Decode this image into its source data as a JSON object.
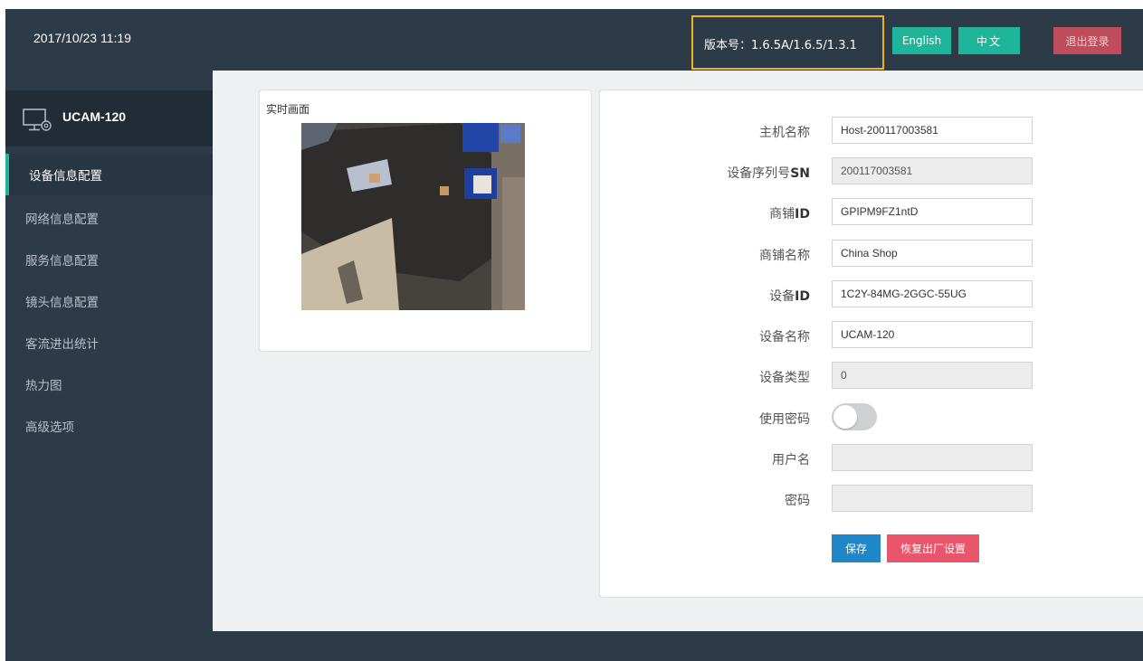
{
  "header": {
    "datetime": "2017/10/23 11:19",
    "version": "版本号：1.6.5A/1.6.5/1.3.1",
    "lang_english": "English",
    "lang_chinese": "中文",
    "logout": "退出登录"
  },
  "sidebar": {
    "device_name": "UCAM-120",
    "device_icon": "monitor-settings-icon",
    "items": [
      {
        "label": "设备信息配置",
        "active": true
      },
      {
        "label": "网络信息配置",
        "active": false
      },
      {
        "label": "服务信息配置",
        "active": false
      },
      {
        "label": "镜头信息配置",
        "active": false
      },
      {
        "label": "客流进出统计",
        "active": false
      },
      {
        "label": "热力图",
        "active": false
      },
      {
        "label": "高级选项",
        "active": false
      }
    ]
  },
  "preview": {
    "title": "实时画面"
  },
  "form": {
    "host_name_label": "主机名称",
    "host_name_value": "Host-200117003581",
    "sn_label_cn": "设备序列号",
    "sn_label_en": "SN",
    "sn_value": "200117003581",
    "shop_id_label_cn": "商铺",
    "shop_id_label_en": "ID",
    "shop_id_value": "GPIPM9FZ1ntD",
    "shop_name_label": "商铺名称",
    "shop_name_value": "China Shop",
    "device_id_label_cn": "设备",
    "device_id_label_en": "ID",
    "device_id_value": "1C2Y-84MG-2GGC-55UG",
    "device_name_label": "设备名称",
    "device_name_value": "UCAM-120",
    "device_type_label": "设备类型",
    "device_type_value": "0",
    "use_password_label": "使用密码",
    "use_password_enabled": false,
    "username_label": "用户名",
    "username_value": "",
    "password_label": "密码",
    "password_value": "",
    "save_label": "保存",
    "reset_label": "恢复出厂设置"
  },
  "colors": {
    "topbar_bg": "#2d3a48",
    "accent_green": "#1fb59a",
    "save_blue": "#1f87c7",
    "reset_red": "#e9556a",
    "logout_red": "#c04d5c",
    "version_highlight": "#f0b41a"
  }
}
